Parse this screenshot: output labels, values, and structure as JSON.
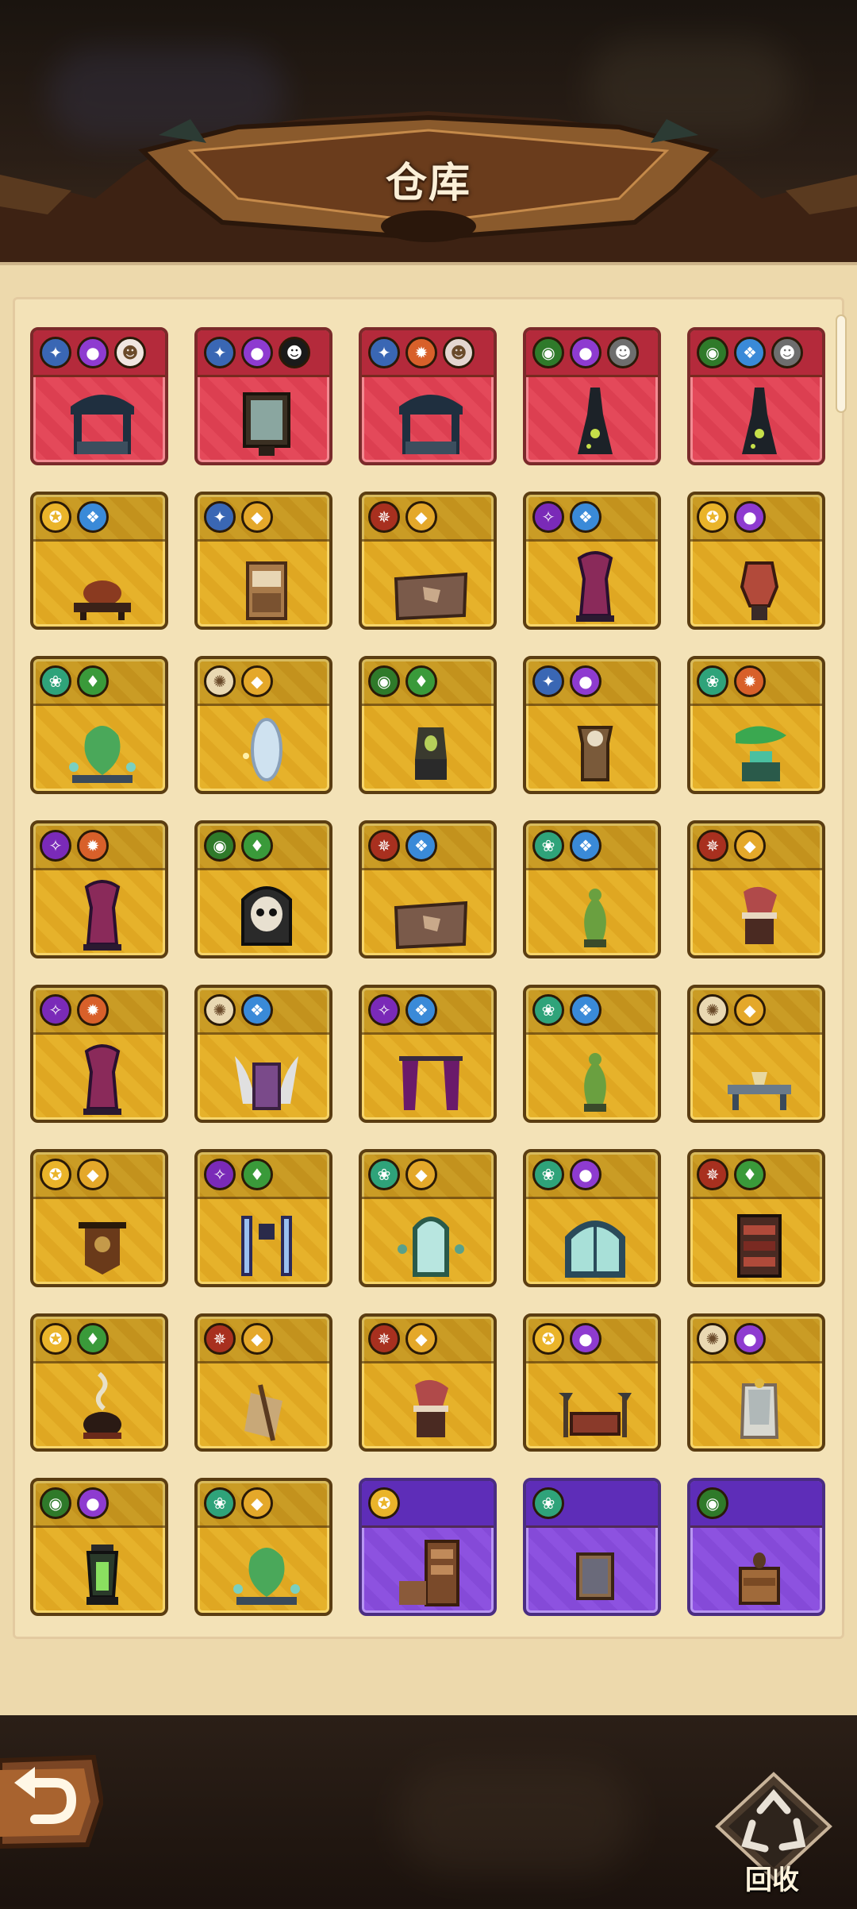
{
  "header": {
    "title": "仓库"
  },
  "footer": {
    "recycle_label": "回收"
  },
  "badge_colors": {
    "star": "#3a67b4",
    "orb": "#8e3bd0",
    "flame": "#d8602a",
    "shield": "#e4a82a",
    "eye": "#2f7a2a",
    "drop": "#3a9a3a",
    "lotus": "#2fa37a",
    "sun": "#e9d8b2",
    "crest": "#a8301f",
    "gem": "#3a8ad8",
    "cat": "#f0e6e0",
    "hair": "#1a1a1a",
    "lady": "#e4d6d0",
    "rider": "#6e6e6e",
    "sword": "#eab42a",
    "violet": "#7a2ab8"
  },
  "rows": [
    [
      {
        "rarity": "red",
        "badges": [
          "star",
          "orb",
          "cat"
        ],
        "item": "canopy-bed"
      },
      {
        "rarity": "red",
        "badges": [
          "star",
          "orb",
          "hair"
        ],
        "item": "portrait-frame"
      },
      {
        "rarity": "red",
        "badges": [
          "star",
          "flame",
          "lady"
        ],
        "item": "canopy-bed"
      },
      {
        "rarity": "red",
        "badges": [
          "eye",
          "orb",
          "rider"
        ],
        "item": "dark-tower"
      },
      {
        "rarity": "red",
        "badges": [
          "eye",
          "gem",
          "rider"
        ],
        "item": "dark-tower"
      }
    ],
    [
      {
        "rarity": "gold",
        "badges": [
          "sword",
          "gem"
        ],
        "item": "grill"
      },
      {
        "rarity": "gold",
        "badges": [
          "star",
          "shield"
        ],
        "item": "cabinet"
      },
      {
        "rarity": "gold",
        "badges": [
          "crest",
          "shield"
        ],
        "item": "map-board"
      },
      {
        "rarity": "gold",
        "badges": [
          "violet",
          "gem"
        ],
        "item": "throne"
      },
      {
        "rarity": "gold",
        "badges": [
          "sword",
          "orb"
        ],
        "item": "urn"
      }
    ],
    [
      {
        "rarity": "gold",
        "badges": [
          "lotus",
          "drop"
        ],
        "item": "vine-fountain"
      },
      {
        "rarity": "gold",
        "badges": [
          "sun",
          "shield"
        ],
        "item": "mirror"
      },
      {
        "rarity": "gold",
        "badges": [
          "eye",
          "drop"
        ],
        "item": "shrine"
      },
      {
        "rarity": "gold",
        "badges": [
          "star",
          "orb"
        ],
        "item": "clock"
      },
      {
        "rarity": "gold",
        "badges": [
          "lotus",
          "flame"
        ],
        "item": "leaf-altar"
      }
    ],
    [
      {
        "rarity": "gold",
        "badges": [
          "violet",
          "flame"
        ],
        "item": "throne"
      },
      {
        "rarity": "gold",
        "badges": [
          "eye",
          "drop"
        ],
        "item": "skull-gate"
      },
      {
        "rarity": "gold",
        "badges": [
          "crest",
          "gem"
        ],
        "item": "map-board"
      },
      {
        "rarity": "gold",
        "badges": [
          "lotus",
          "gem"
        ],
        "item": "statue"
      },
      {
        "rarity": "gold",
        "badges": [
          "crest",
          "shield"
        ],
        "item": "drum"
      }
    ],
    [
      {
        "rarity": "gold",
        "badges": [
          "violet",
          "flame"
        ],
        "item": "throne"
      },
      {
        "rarity": "gold",
        "badges": [
          "sun",
          "gem"
        ],
        "item": "winged-throne"
      },
      {
        "rarity": "gold",
        "badges": [
          "violet",
          "gem"
        ],
        "item": "curtains"
      },
      {
        "rarity": "gold",
        "badges": [
          "lotus",
          "gem"
        ],
        "item": "statue"
      },
      {
        "rarity": "gold",
        "badges": [
          "sun",
          "shield"
        ],
        "item": "dining-table"
      }
    ],
    [
      {
        "rarity": "gold",
        "badges": [
          "sword",
          "shield"
        ],
        "item": "banner"
      },
      {
        "rarity": "gold",
        "badges": [
          "violet",
          "drop"
        ],
        "item": "pillars"
      },
      {
        "rarity": "gold",
        "badges": [
          "lotus",
          "shield"
        ],
        "item": "gate-window"
      },
      {
        "rarity": "gold",
        "badges": [
          "lotus",
          "orb"
        ],
        "item": "arch-window"
      },
      {
        "rarity": "gold",
        "badges": [
          "crest",
          "drop"
        ],
        "item": "bookshelf"
      }
    ],
    [
      {
        "rarity": "gold",
        "badges": [
          "sword",
          "drop"
        ],
        "item": "cauldron"
      },
      {
        "rarity": "gold",
        "badges": [
          "crest",
          "shield"
        ],
        "item": "scroll"
      },
      {
        "rarity": "gold",
        "badges": [
          "crest",
          "shield"
        ],
        "item": "drum"
      },
      {
        "rarity": "gold",
        "badges": [
          "sword",
          "orb"
        ],
        "item": "bed-axes"
      },
      {
        "rarity": "gold",
        "badges": [
          "sun",
          "orb"
        ],
        "item": "white-throne"
      }
    ],
    [
      {
        "rarity": "gold",
        "badges": [
          "eye",
          "orb"
        ],
        "item": "lantern"
      },
      {
        "rarity": "gold",
        "badges": [
          "lotus",
          "shield"
        ],
        "item": "vine-fountain"
      },
      {
        "rarity": "purple",
        "badges": [
          "sword"
        ],
        "item": "bookcase"
      },
      {
        "rarity": "purple",
        "badges": [
          "lotus"
        ],
        "item": "frame"
      },
      {
        "rarity": "purple",
        "badges": [
          "eye"
        ],
        "item": "nightstand"
      }
    ]
  ]
}
